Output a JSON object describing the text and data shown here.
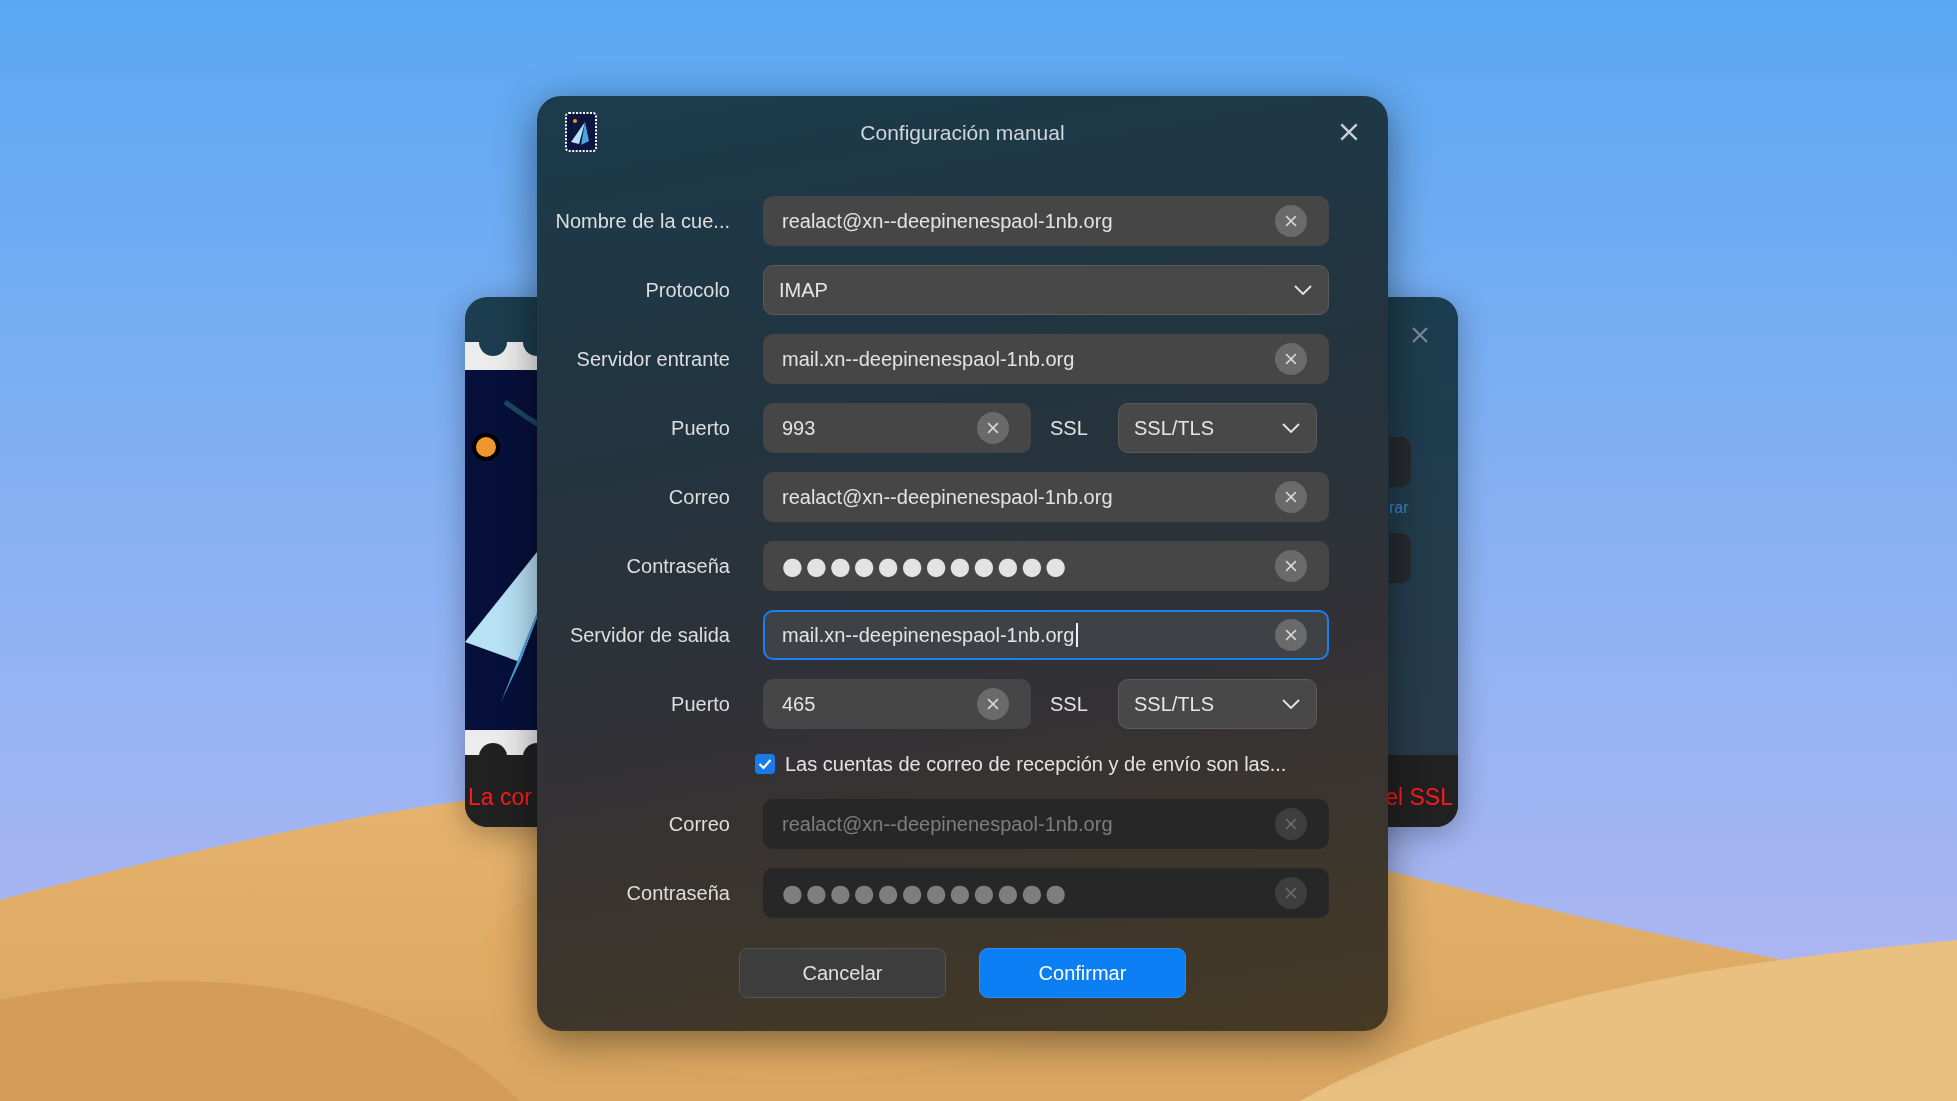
{
  "background_window": {
    "link_fragment": "rar",
    "error_fragments": [
      "La cor",
      "el SSL"
    ]
  },
  "dialog": {
    "title": "Configuración manual",
    "rows": [
      {
        "kind": "text",
        "label": "Nombre de la cue...",
        "value": "realact@xn--deepinenespaol-1nb.org",
        "focused": false,
        "disabled": false
      },
      {
        "kind": "select",
        "label": "Protocolo",
        "value": "IMAP"
      },
      {
        "kind": "text",
        "label": "Servidor entrante",
        "value": "mail.xn--deepinenespaol-1nb.org",
        "focused": false,
        "disabled": false
      },
      {
        "kind": "port",
        "label": "Puerto",
        "value": "993",
        "ssl_label": "SSL",
        "ssl_value": "SSL/TLS"
      },
      {
        "kind": "text",
        "label": "Correo",
        "value": "realact@xn--deepinenespaol-1nb.org",
        "focused": false,
        "disabled": false
      },
      {
        "kind": "password",
        "label": "Contraseña",
        "value": "●●●●●●●●●●●●",
        "focused": false,
        "disabled": false
      },
      {
        "kind": "text",
        "label": "Servidor de salida",
        "value": "mail.xn--deepinenespaol-1nb.org",
        "focused": true,
        "disabled": false
      },
      {
        "kind": "port",
        "label": "Puerto",
        "value": "465",
        "ssl_label": "SSL",
        "ssl_value": "SSL/TLS"
      },
      {
        "kind": "checkbox",
        "label": "Las cuentas de correo de recepción y de envío son las...",
        "checked": true
      },
      {
        "kind": "text",
        "label": "Correo",
        "value": "realact@xn--deepinenespaol-1nb.org",
        "focused": false,
        "disabled": true
      },
      {
        "kind": "password",
        "label": "Contraseña",
        "value": "●●●●●●●●●●●●",
        "focused": false,
        "disabled": true
      }
    ],
    "buttons": [
      {
        "label": "Cancelar",
        "kind": "secondary"
      },
      {
        "label": "Confirmar",
        "kind": "primary"
      }
    ]
  }
}
